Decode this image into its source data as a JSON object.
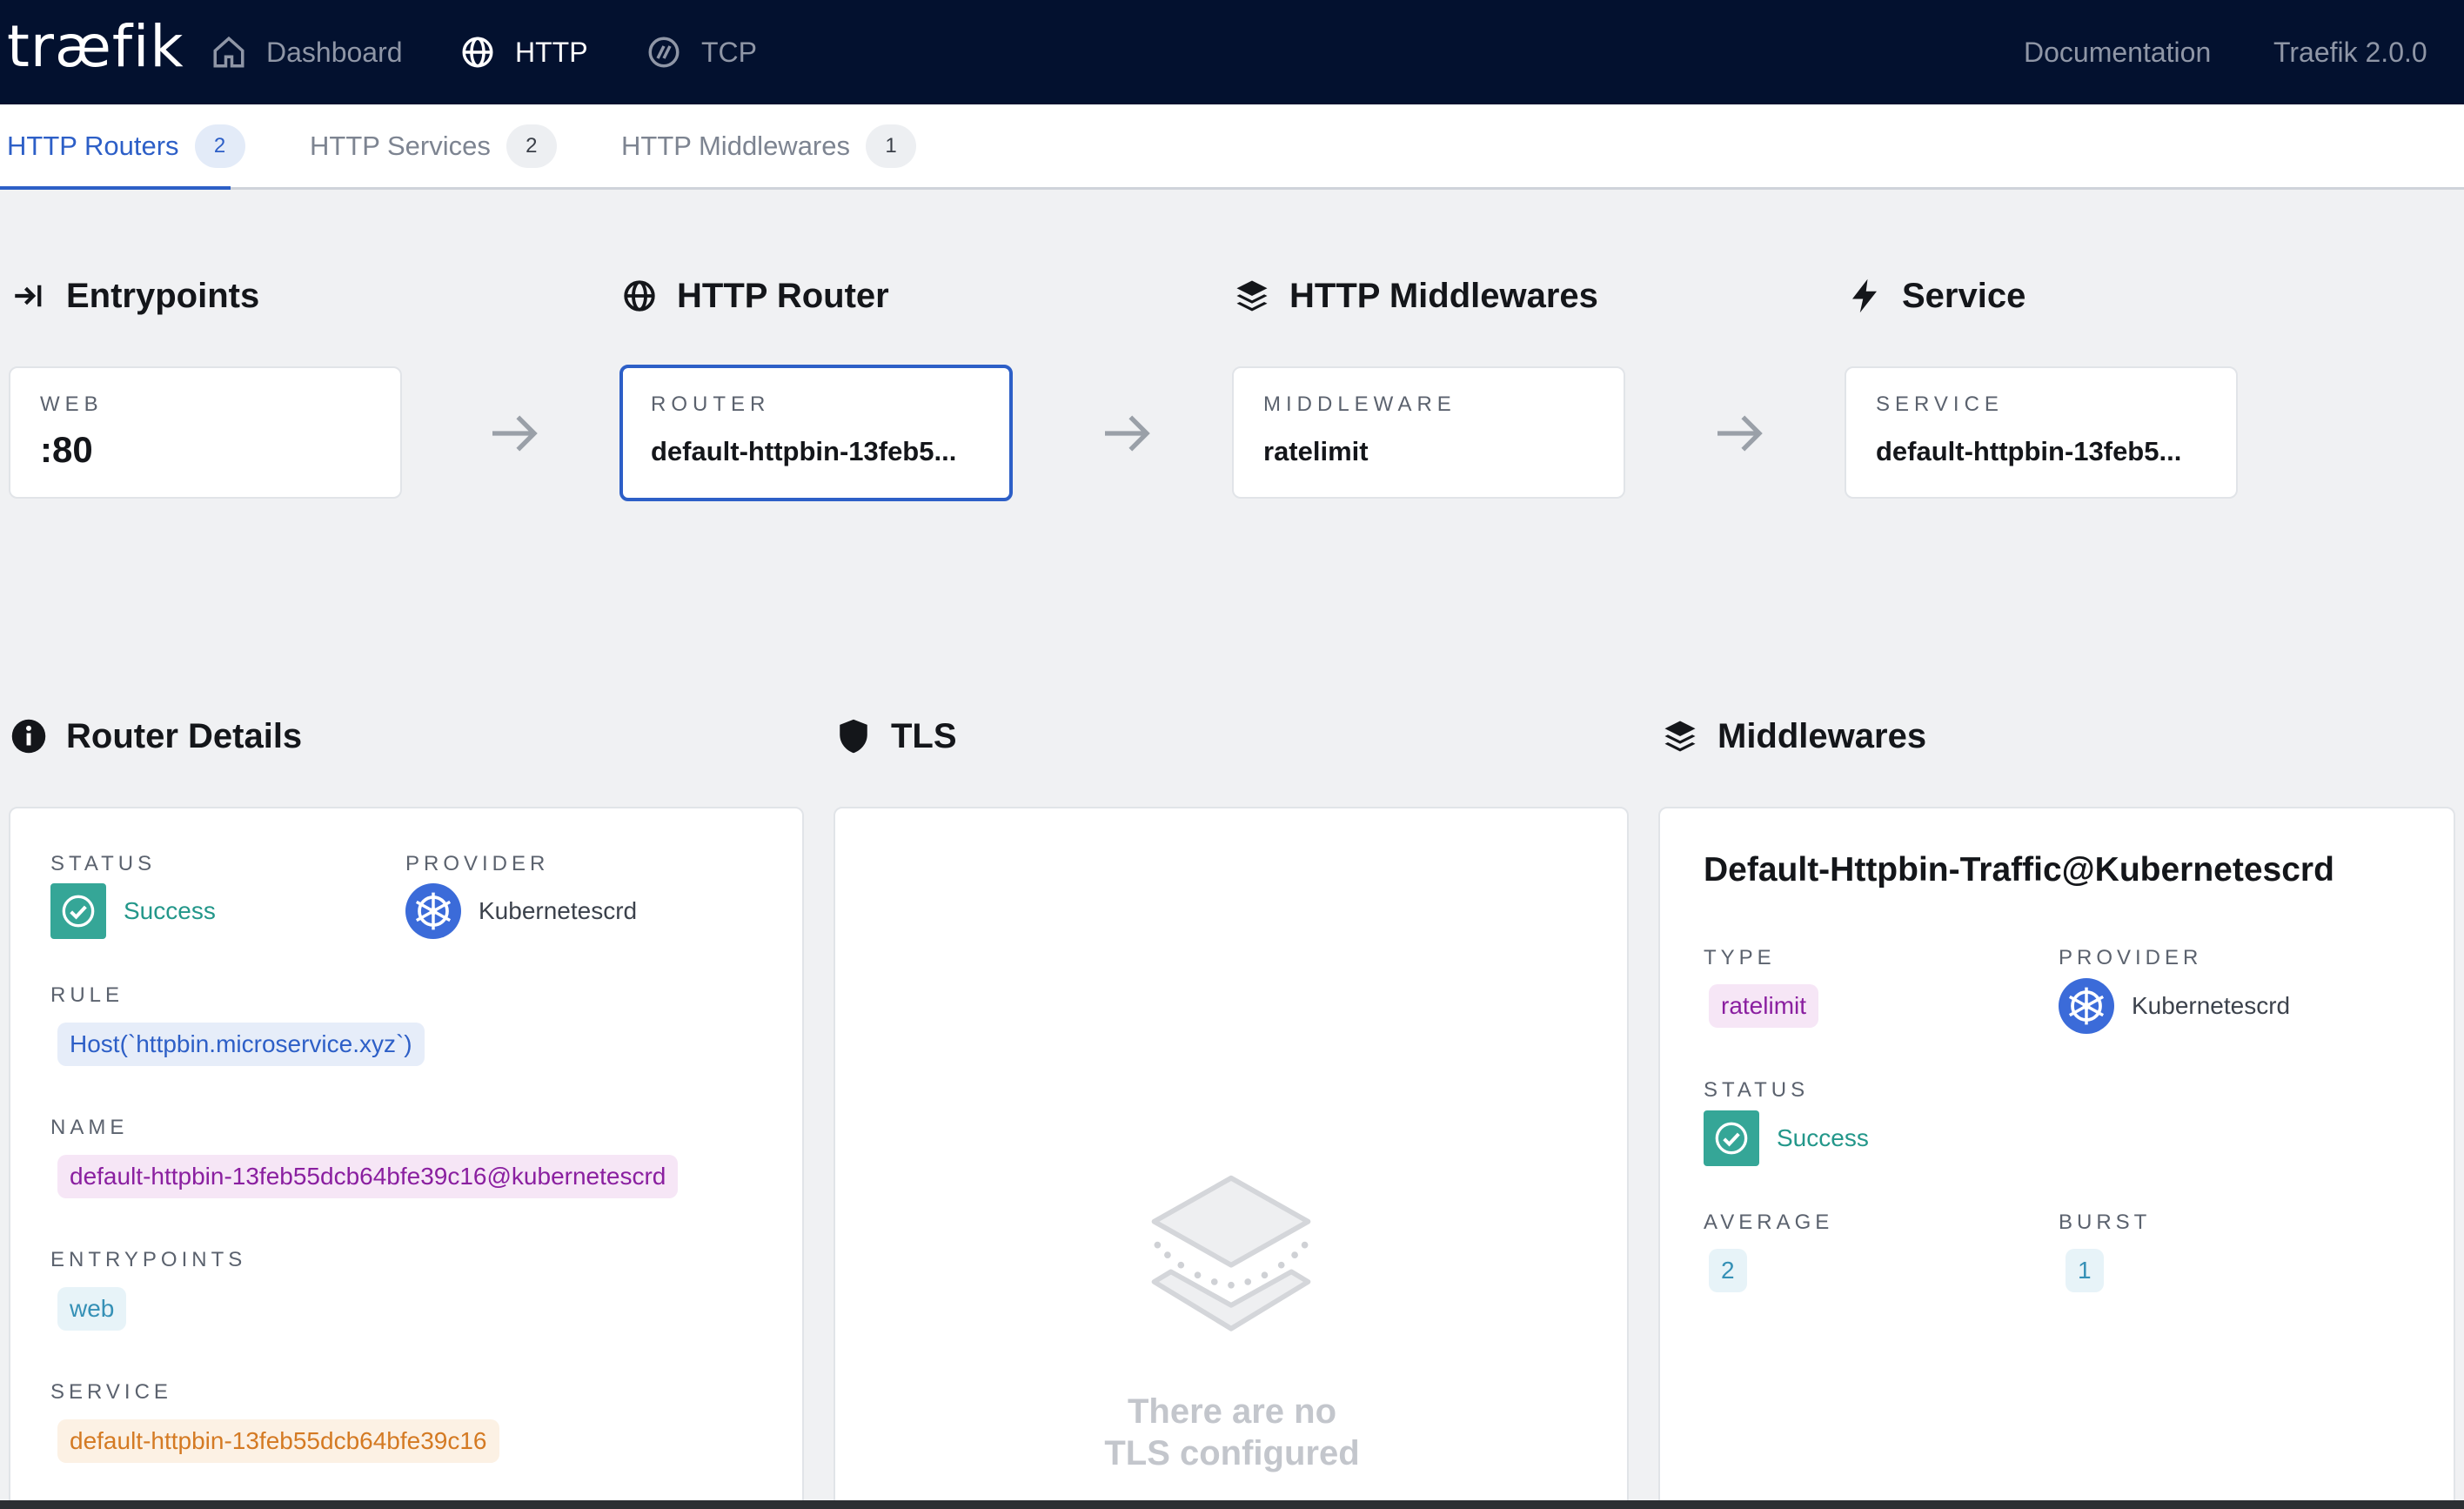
{
  "navbar": {
    "logo": "træfik",
    "links": [
      {
        "label": "Dashboard",
        "icon": "home-icon"
      },
      {
        "label": "HTTP",
        "icon": "globe-icon"
      },
      {
        "label": "TCP",
        "icon": "tcp-icon"
      }
    ],
    "documentation": "Documentation",
    "version": "Traefik 2.0.0"
  },
  "subtabs": [
    {
      "label": "HTTP Routers",
      "count": "2"
    },
    {
      "label": "HTTP Services",
      "count": "2"
    },
    {
      "label": "HTTP Middlewares",
      "count": "1"
    }
  ],
  "flow": {
    "entrypoints": {
      "heading": "Entrypoints",
      "label": "WEB",
      "value": ":80",
      "icon": "entrypoint-icon"
    },
    "router": {
      "heading": "HTTP Router",
      "label": "ROUTER",
      "value": "default-httpbin-13feb5...",
      "icon": "globe-icon"
    },
    "middlewares": {
      "heading": "HTTP Middlewares",
      "label": "MIDDLEWARE",
      "value": "ratelimit",
      "icon": "layers-icon"
    },
    "service": {
      "heading": "Service",
      "label": "SERVICE",
      "value": "default-httpbin-13feb5...",
      "icon": "lightning-icon"
    }
  },
  "router_details": {
    "heading": "Router Details",
    "status_label": "STATUS",
    "status": "Success",
    "provider_label": "PROVIDER",
    "provider": "Kubernetescrd",
    "rule_label": "RULE",
    "rule": "Host(`httpbin.microservice.xyz`)",
    "name_label": "NAME",
    "name": "default-httpbin-13feb55dcb64bfe39c16@kubernetescrd",
    "entrypoints_label": "ENTRYPOINTS",
    "entrypoints": "web",
    "service_label": "SERVICE",
    "service": "default-httpbin-13feb55dcb64bfe39c16"
  },
  "tls": {
    "heading": "TLS",
    "empty_line1": "There are no",
    "empty_line2": "TLS configured"
  },
  "middlewares_panel": {
    "heading": "Middlewares",
    "title": "Default-Httpbin-Traffic@Kubernetescrd",
    "type_label": "TYPE",
    "type": "ratelimit",
    "provider_label": "PROVIDER",
    "provider": "Kubernetescrd",
    "status_label": "STATUS",
    "status": "Success",
    "average_label": "AVERAGE",
    "average": "2",
    "burst_label": "BURST",
    "burst": "1"
  },
  "colors": {
    "navbar_bg": "#03112f",
    "accent": "#2d5fc7",
    "success": "#35a697"
  }
}
